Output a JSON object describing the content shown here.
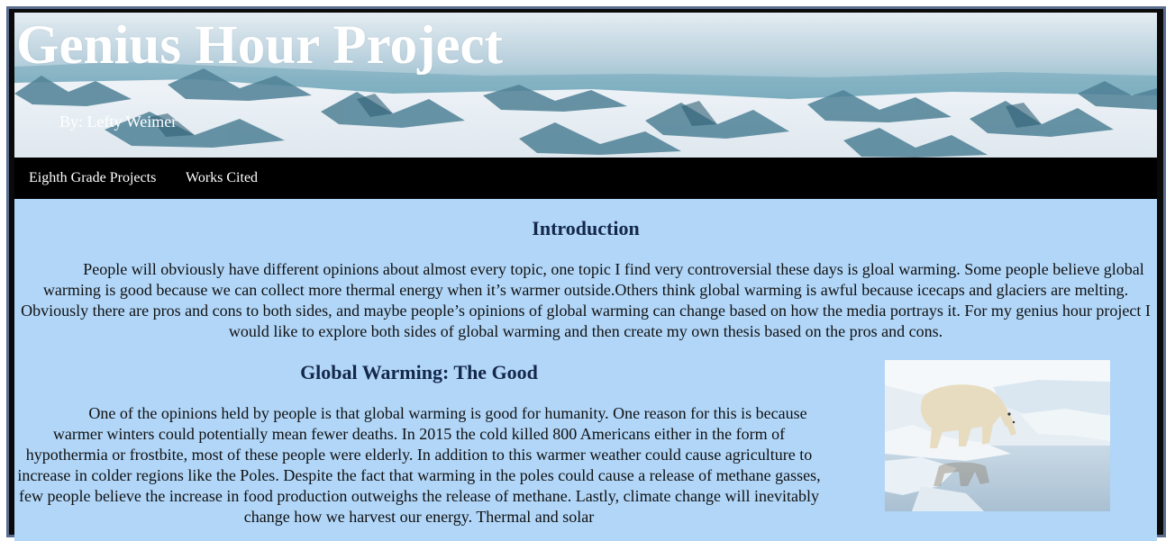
{
  "header": {
    "title": "Genius Hour Project",
    "byline": "By: Lefty Weimer"
  },
  "nav": {
    "items": [
      {
        "label": "Eighth Grade Projects"
      },
      {
        "label": "Works Cited"
      }
    ]
  },
  "intro": {
    "heading": "Introduction",
    "text": "People will obviously have different opinions about almost every topic, one topic I find very controversial these days is gloal warming. Some people believe global warming is good because we can collect more thermal energy when it’s warmer outside.Others think global warming is awful because icecaps and glaciers are melting. Obviously there are pros and cons to both sides, and maybe people’s opinions of global warming can change based on how the media portrays it. For my genius hour project I would like to explore both sides of global warming and then create my own thesis based on the pros and cons."
  },
  "good_section": {
    "heading": "Global Warming: The Good",
    "text": "One of the opinions held by people is that global warming is good for humanity. One reason for this is because warmer winters could potentially mean fewer deaths. In 2015 the cold killed 800 Americans either in the form of hypothermia or frostbite, most of these people were elderly. In addition to this warmer weather could cause agriculture to increase in colder regions like the Poles. Despite the fact that warming in the poles could cause a release of methane gasses, few people believe the increase in food production outweighs the release of methane. Lastly, climate change will inevitably change how we harvest our energy. Thermal and solar"
  },
  "colors": {
    "frame": "#0a0a0a",
    "nav_background": "#000000",
    "content_background": "#b1d6f8",
    "heading_text": "#14284a",
    "header_text": "#ffffff"
  },
  "icons": {
    "header_image": "snowy-mountains-banner",
    "section_image": "polar-bear-on-ice-photo"
  }
}
